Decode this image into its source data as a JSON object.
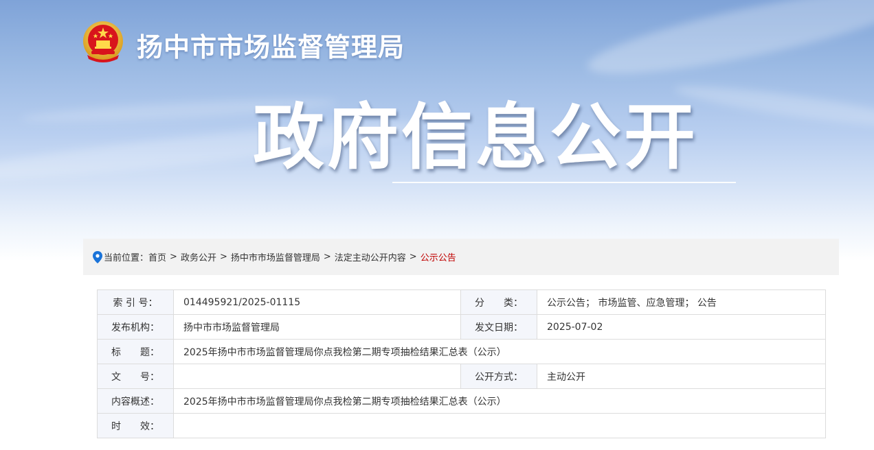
{
  "header": {
    "site_name": "扬中市市场监督管理局",
    "banner_title": "政府信息公开",
    "emblem_icon": "national-emblem-icon"
  },
  "breadcrumb": {
    "prefix": "当前位置：",
    "items": [
      "首页",
      "政务公开",
      "扬中市市场监督管理局",
      "法定主动公开内容"
    ],
    "current": "公示公告",
    "separator": ">"
  },
  "info": {
    "index_label": "索 引 号：",
    "index_value": "014495921/2025-01115",
    "category_label": "分　　类：",
    "category_value": "公示公告； 市场监管、应急管理； 公告",
    "publisher_label": "发布机构：",
    "publisher_value": "扬中市市场监督管理局",
    "date_label": "发文日期：",
    "date_value": "2025-07-02",
    "title_label": "标　　题：",
    "title_value": "2025年扬中市市场监督管理局你点我检第二期专项抽检结果汇总表（公示）",
    "docno_label": "文　　号：",
    "docno_value": "",
    "method_label": "公开方式：",
    "method_value": "主动公开",
    "summary_label": "内容概述：",
    "summary_value": "2025年扬中市市场监督管理局你点我检第二期专项抽检结果汇总表（公示）",
    "validity_label": "时　　效：",
    "validity_value": ""
  },
  "colors": {
    "current_crumb": "#c00000",
    "label_bg": "#f4f6fb",
    "border": "#dcdcdc"
  }
}
